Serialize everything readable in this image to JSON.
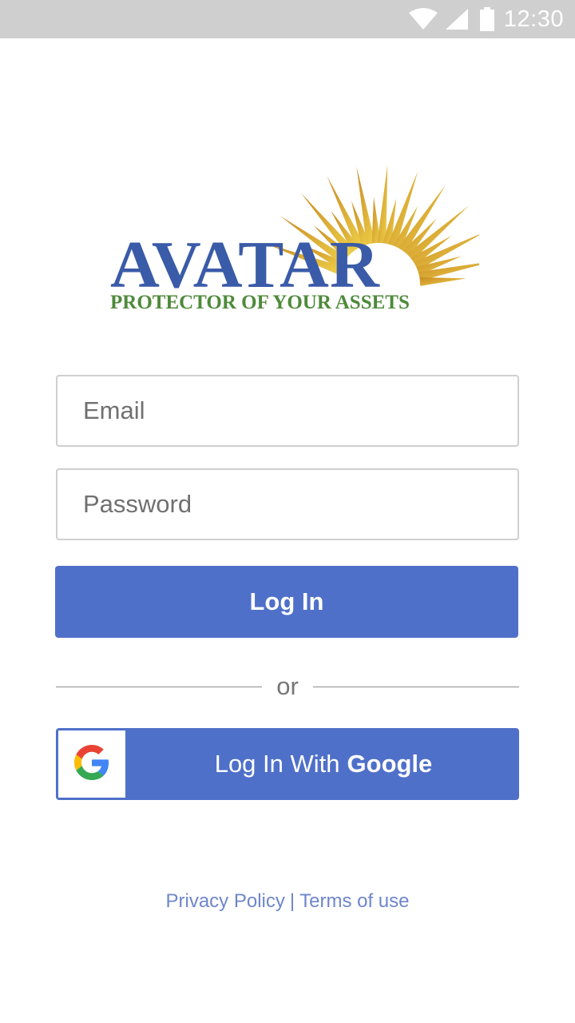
{
  "status_bar": {
    "time": "12:30",
    "icons": [
      "wifi-icon",
      "signal-icon",
      "battery-icon"
    ],
    "background": "#cfcfcf"
  },
  "logo": {
    "wordmark": "AVATAR",
    "tagline": "PROTECTOR OF YOUR ASSETS",
    "wordmark_color": "#3a5ba8",
    "tagline_color": "#4e8a3a",
    "sun_color": "#d9a630"
  },
  "form": {
    "email_placeholder": "Email",
    "email_value": "",
    "password_placeholder": "Password",
    "password_value": "",
    "login_label": "Log In",
    "divider_text": "or",
    "google_label_prefix": "Log In With",
    "google_label_brand": "Google",
    "accent_color": "#4f70c9"
  },
  "footer": {
    "privacy_label": "Privacy Policy",
    "separator": "|",
    "terms_label": "Terms of use",
    "link_color": "#6f86cc"
  }
}
